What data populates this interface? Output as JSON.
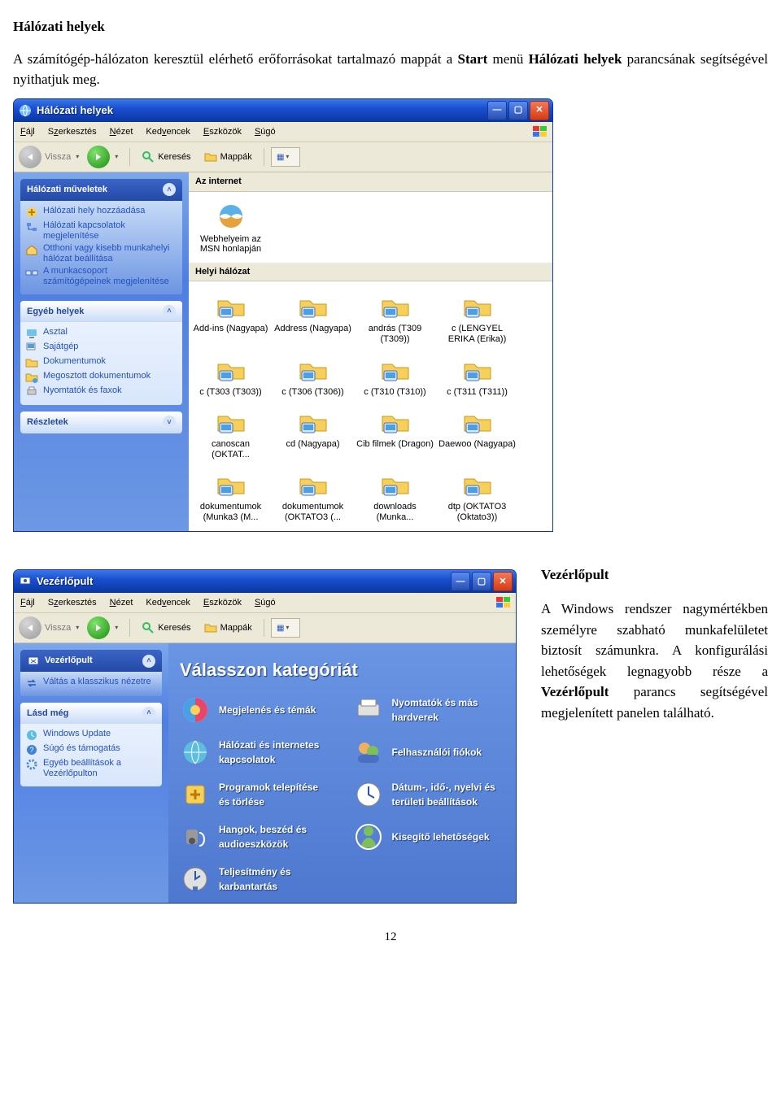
{
  "doc": {
    "title": "Hálózati helyek",
    "paragraph": "A számítógép-hálózaton keresztül elérhető erőforrásokat tartalmazó mappát a Start menü Hálózati helyek parancsának segítségével nyithatjuk meg.",
    "page": "12"
  },
  "win1": {
    "title": "Hálózati helyek",
    "menu": [
      "Fájl",
      "Szerkesztés",
      "Nézet",
      "Kedvencek",
      "Eszközök",
      "Súgó"
    ],
    "back": "Vissza",
    "tbtn_search": "Keresés",
    "tbtn_folders": "Mappák",
    "side": {
      "panel1": {
        "title": "Hálózati műveletek",
        "items": [
          "Hálózati hely hozzáadása",
          "Hálózati kapcsolatok megjelenítése",
          "Otthoni vagy kisebb munkahelyi hálózat beállítása",
          "A munkacsoport számítógépeinek megjelenítése"
        ]
      },
      "panel2": {
        "title": "Egyéb helyek",
        "items": [
          "Asztal",
          "Sajátgép",
          "Dokumentumok",
          "Megosztott dokumentumok",
          "Nyomtatók és faxok"
        ]
      },
      "panel3": {
        "title": "Részletek"
      }
    },
    "group1": {
      "title": "Az internet",
      "items": [
        "Webhelyeim az MSN honlapján"
      ]
    },
    "group2": {
      "title": "Helyi hálózat",
      "items": [
        "Add-ins (Nagyapa)",
        "Address (Nagyapa)",
        "andrás (T309 (T309))",
        "c (LENGYEL ERIKA (Erika))",
        "c (T303 (T303))",
        "c (T306 (T306))",
        "c (T310 (T310))",
        "c (T311 (T311))",
        "canoscan (OKTAT...",
        "cd (Nagyapa)",
        "Cib filmek (Dragon)",
        "Daewoo (Nagyapa)",
        "dokumentumok (Munka3 (M...",
        "dokumentumok (OKTATO3 (...",
        "downloads (Munka...",
        "dtp (OKTATO3 (Oktato3))"
      ]
    }
  },
  "win2": {
    "title": "Vezérlőpult",
    "menu": [
      "Fájl",
      "Szerkesztés",
      "Nézet",
      "Kedvencek",
      "Eszközök",
      "Súgó"
    ],
    "back": "Vissza",
    "tbtn_search": "Keresés",
    "tbtn_folders": "Mappák",
    "side": {
      "panel1": {
        "title": "Vezérlőpult",
        "items": [
          "Váltás a klasszikus nézetre"
        ]
      },
      "panel2": {
        "title": "Lásd még",
        "items": [
          "Windows Update",
          "Súgó és támogatás",
          "Egyéb beállítások a Vezérlőpulton"
        ]
      }
    },
    "catheader": "Válasszon kategóriát",
    "cats": [
      "Megjelenés és témák",
      "Nyomtatók és más hardverek",
      "Hálózati és internetes kapcsolatok",
      "Felhasználói fiókok",
      "Programok telepítése és törlése",
      "Dátum-, idő-, nyelvi és területi beállítások",
      "Hangok, beszéd és audioeszközök",
      "Kisegítő lehetőségek",
      "Teljesítmény és karbantartás"
    ]
  },
  "vezer": {
    "title": "Vezérlőpult",
    "p": "A Windows rendszer nagymértékben személyre szabható munkafelületet biztosít számunkra. A konfigurálási lehetőségek legnagyobb része a Vezérlőpult parancs segítségével megjelenített panelen található."
  }
}
